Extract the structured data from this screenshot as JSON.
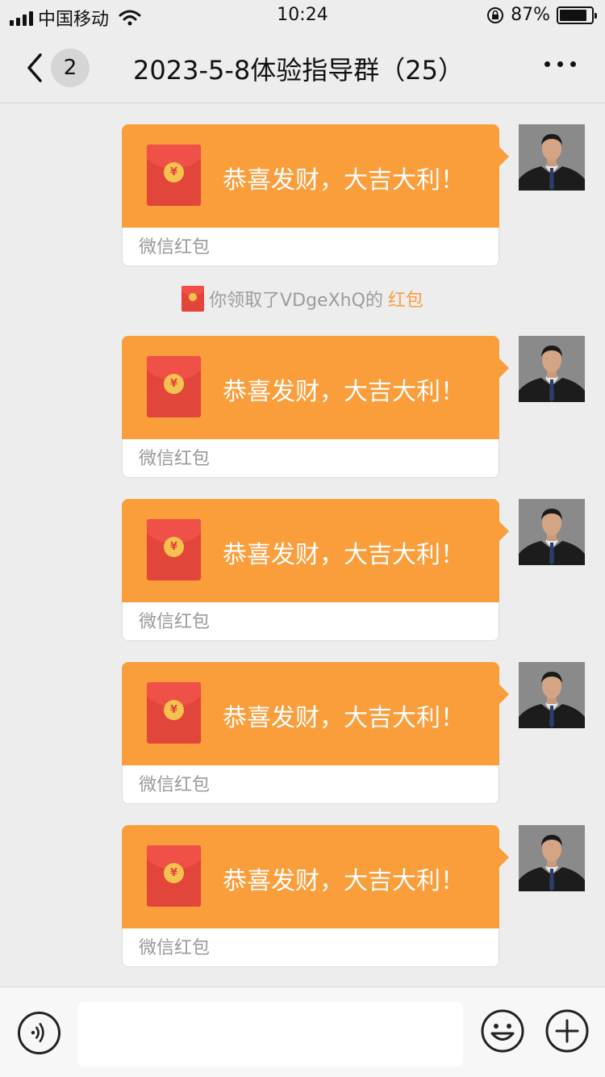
{
  "status_bar": {
    "carrier": "中国移动",
    "time": "10:24",
    "battery_percent": "87%",
    "battery_level": 0.87
  },
  "nav": {
    "back_icon": "chevron-left-icon",
    "unread_count": "2",
    "title": "2023-5-8体验指导群（25）",
    "more_icon": "more-dots-icon"
  },
  "messages": [
    {
      "text": "恭喜发财，大吉大利！",
      "source": "微信红包"
    },
    {
      "text": "恭喜发财，大吉大利！",
      "source": "微信红包"
    },
    {
      "text": "恭喜发财，大吉大利！",
      "source": "微信红包"
    },
    {
      "text": "恭喜发财，大吉大利！",
      "source": "微信红包"
    },
    {
      "text": "恭喜发财，大吉大利！",
      "source": "微信红包"
    }
  ],
  "notice": {
    "prefix": "你领取了VDgeXhQ的",
    "link": "红包"
  },
  "input_bar": {
    "voice_icon": "voice-icon",
    "emoji_icon": "emoji-icon",
    "plus_icon": "plus-icon",
    "input_value": ""
  },
  "colors": {
    "bubble": "#fa9d3b",
    "envelope": "#e2453a",
    "coin": "#f6c24f",
    "background": "#ededed"
  }
}
